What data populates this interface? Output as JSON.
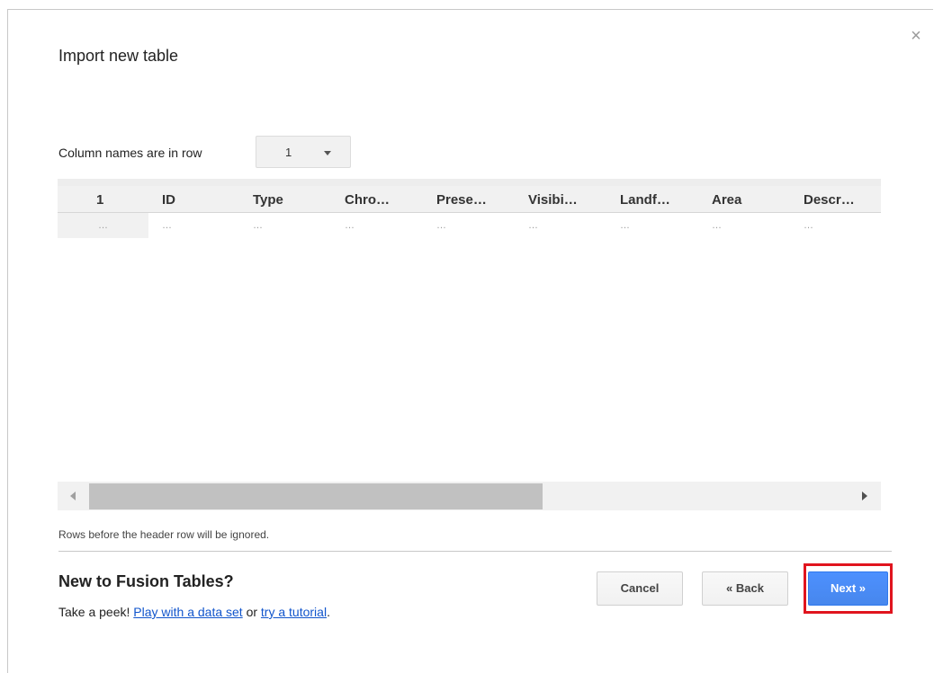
{
  "dialog": {
    "title": "Import new table",
    "close_symbol": "×"
  },
  "column_row": {
    "label": "Column names are in row",
    "selected": "1"
  },
  "table": {
    "headers": [
      "1",
      "ID",
      "Type",
      "Chro…",
      "Prese…",
      "Visibi…",
      "Landf…",
      "Area",
      "Descr…"
    ],
    "row": [
      "…",
      "…",
      "…",
      "…",
      "…",
      "…",
      "…",
      "…",
      "…"
    ]
  },
  "note": "Rows before the header row will be ignored.",
  "help": {
    "heading": "New to Fusion Tables?",
    "prefix": "Take a peek! ",
    "link1": "Play with a data set",
    "middle": " or ",
    "link2": "try a tutorial",
    "suffix": "."
  },
  "buttons": {
    "cancel": "Cancel",
    "back": "« Back",
    "next": "Next »"
  },
  "colors": {
    "accent": "#4d90fe",
    "highlight": "#e0141e",
    "link": "#1155cc"
  }
}
